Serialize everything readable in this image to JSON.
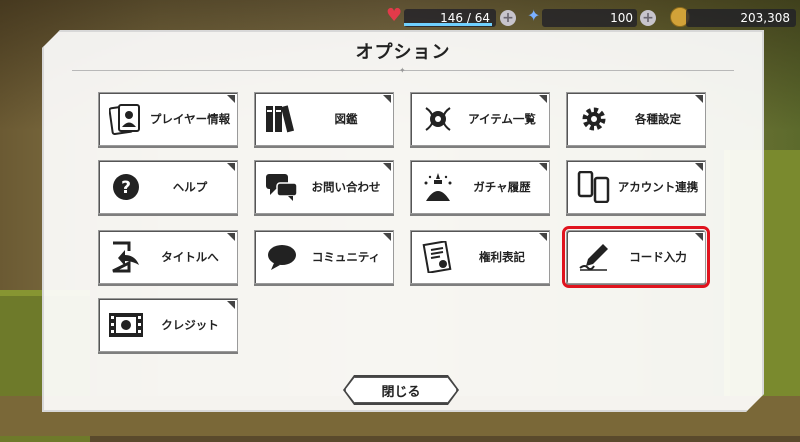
{
  "status": {
    "hp_text": "146 / 64",
    "gems": "100",
    "coins": "203,308",
    "colors": {
      "hp": "#e23a4a",
      "gem": "#7ab0ff",
      "coin": "#d2a238"
    }
  },
  "dialog": {
    "title": "オプション",
    "close_label": "閉じる",
    "options": [
      {
        "label": "プレイヤー情報",
        "icon": "player-card-icon"
      },
      {
        "label": "図鑑",
        "icon": "books-icon"
      },
      {
        "label": "アイテム一覧",
        "icon": "item-crest-icon"
      },
      {
        "label": "各種設定",
        "icon": "gear-icon"
      },
      {
        "label": "ヘルプ",
        "icon": "help-icon"
      },
      {
        "label": "お問い合わせ",
        "icon": "chat-bubbles-icon"
      },
      {
        "label": "ガチャ履歴",
        "icon": "gacha-altar-icon"
      },
      {
        "label": "アカウント連携",
        "icon": "phones-link-icon"
      },
      {
        "label": "タイトルへ",
        "icon": "exit-door-icon"
      },
      {
        "label": "コミュニティ",
        "icon": "speech-bubble-icon"
      },
      {
        "label": "権利表記",
        "icon": "certificate-icon"
      },
      {
        "label": "コード入力",
        "icon": "pen-write-icon",
        "selected": true
      },
      {
        "label": "クレジット",
        "icon": "film-reel-icon"
      }
    ]
  }
}
